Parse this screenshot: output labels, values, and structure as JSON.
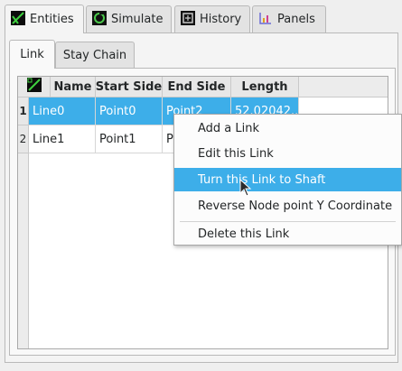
{
  "main_tabs": [
    {
      "label": "Entities",
      "icon": "entities-icon"
    },
    {
      "label": "Simulate",
      "icon": "simulate-icon"
    },
    {
      "label": "History",
      "icon": "history-icon"
    },
    {
      "label": "Panels",
      "icon": "panels-icon"
    }
  ],
  "sub_tabs": [
    "Link",
    "Stay Chain"
  ],
  "table": {
    "corner_icon": "link-icon",
    "columns": [
      "Name",
      "Start Side",
      "End Side",
      "Length"
    ],
    "rows": [
      {
        "num": "1",
        "name": "Line0",
        "start": "Point0",
        "end": "Point2",
        "length": "52.02042..."
      },
      {
        "num": "2",
        "name": "Line1",
        "start": "Point1",
        "end": "P",
        "length": ""
      }
    ]
  },
  "context_menu": {
    "items": [
      "Add a Link",
      "Edit this Link",
      "Turn this Link to Shaft",
      "Reverse Node point Y Coordinate",
      "Delete this Link"
    ],
    "highlighted": "Turn this Link to Shaft"
  },
  "colors": {
    "selection": "#3daee9"
  }
}
